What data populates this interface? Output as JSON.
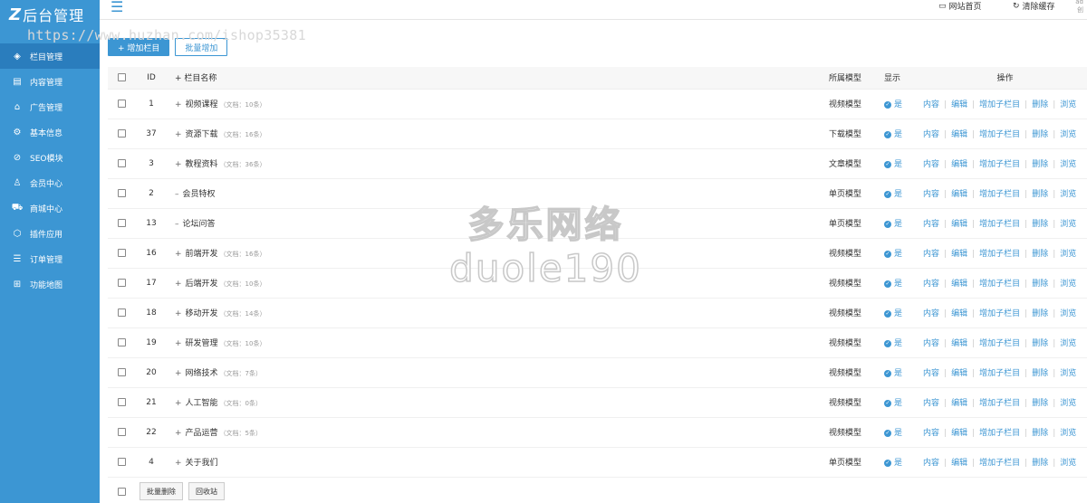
{
  "logo": {
    "mark": "Z",
    "title": "后台管理"
  },
  "sidebar": {
    "items": [
      {
        "label": "栏目管理",
        "icon": "layers-icon",
        "glyph": "◈",
        "active": true
      },
      {
        "label": "内容管理",
        "icon": "document-icon",
        "glyph": "▤",
        "active": false
      },
      {
        "label": "广告管理",
        "icon": "home-icon",
        "glyph": "⌂",
        "active": false
      },
      {
        "label": "基本信息",
        "icon": "gear-icon",
        "glyph": "⚙",
        "active": false
      },
      {
        "label": "SEO模块",
        "icon": "prohibit-icon",
        "glyph": "⊘",
        "active": false
      },
      {
        "label": "会员中心",
        "icon": "user-icon",
        "glyph": "♙",
        "active": false
      },
      {
        "label": "商城中心",
        "icon": "cart-icon",
        "glyph": "⛟",
        "active": false
      },
      {
        "label": "插件应用",
        "icon": "cube-icon",
        "glyph": "⬡",
        "active": false
      },
      {
        "label": "订单管理",
        "icon": "list-icon",
        "glyph": "☰",
        "active": false
      },
      {
        "label": "功能地图",
        "icon": "grid-icon",
        "glyph": "⊞",
        "active": false
      }
    ]
  },
  "header": {
    "menu_icon": "☰",
    "site_home": "网站首页",
    "clear_cache": "清除缓存",
    "user_line1": "ad",
    "user_line2": "创"
  },
  "watermark": {
    "url": "https://www.huzhan.com/ishop35381",
    "cn": "多乐网络",
    "en": "duole190"
  },
  "toolbar": {
    "add_label": "+ 增加栏目",
    "batch_add_label": "批量增加"
  },
  "table": {
    "headers": {
      "id": "ID",
      "name": "+ 栏目名称",
      "model": "所属模型",
      "show": "显示",
      "ops": "操作"
    },
    "ops": [
      "内容",
      "编辑",
      "增加子栏目",
      "删除",
      "浏览"
    ],
    "rows": [
      {
        "id": "1",
        "sign": "+",
        "name": "视频课程",
        "doc": "（文档：10条）",
        "model": "视频模型",
        "show": "是"
      },
      {
        "id": "37",
        "sign": "+",
        "name": "资源下载",
        "doc": "（文档：16条）",
        "model": "下载模型",
        "show": "是"
      },
      {
        "id": "3",
        "sign": "+",
        "name": "教程资料",
        "doc": "（文档：36条）",
        "model": "文章模型",
        "show": "是"
      },
      {
        "id": "2",
        "sign": "–",
        "name": "会员特权",
        "doc": "",
        "model": "单页模型",
        "show": "是"
      },
      {
        "id": "13",
        "sign": "–",
        "name": "论坛问答",
        "doc": "",
        "model": "单页模型",
        "show": "是"
      },
      {
        "id": "16",
        "sign": "+",
        "name": "前端开发",
        "doc": "（文档：16条）",
        "model": "视频模型",
        "show": "是"
      },
      {
        "id": "17",
        "sign": "+",
        "name": "后端开发",
        "doc": "（文档：10条）",
        "model": "视频模型",
        "show": "是"
      },
      {
        "id": "18",
        "sign": "+",
        "name": "移动开发",
        "doc": "（文档：14条）",
        "model": "视频模型",
        "show": "是"
      },
      {
        "id": "19",
        "sign": "+",
        "name": "研发管理",
        "doc": "（文档：10条）",
        "model": "视频模型",
        "show": "是"
      },
      {
        "id": "20",
        "sign": "+",
        "name": "网络技术",
        "doc": "（文档：7条）",
        "model": "视频模型",
        "show": "是"
      },
      {
        "id": "21",
        "sign": "+",
        "name": "人工智能",
        "doc": "（文档：0条）",
        "model": "视频模型",
        "show": "是"
      },
      {
        "id": "22",
        "sign": "+",
        "name": "产品运营",
        "doc": "（文档：5条）",
        "model": "视频模型",
        "show": "是"
      },
      {
        "id": "4",
        "sign": "+",
        "name": "关于我们",
        "doc": "",
        "model": "单页模型",
        "show": "是"
      }
    ]
  },
  "bottom": {
    "batch_delete": "批量删除",
    "recycle": "回收站"
  },
  "colors": {
    "primary": "#3c96d3",
    "active": "#2a7dbd"
  }
}
